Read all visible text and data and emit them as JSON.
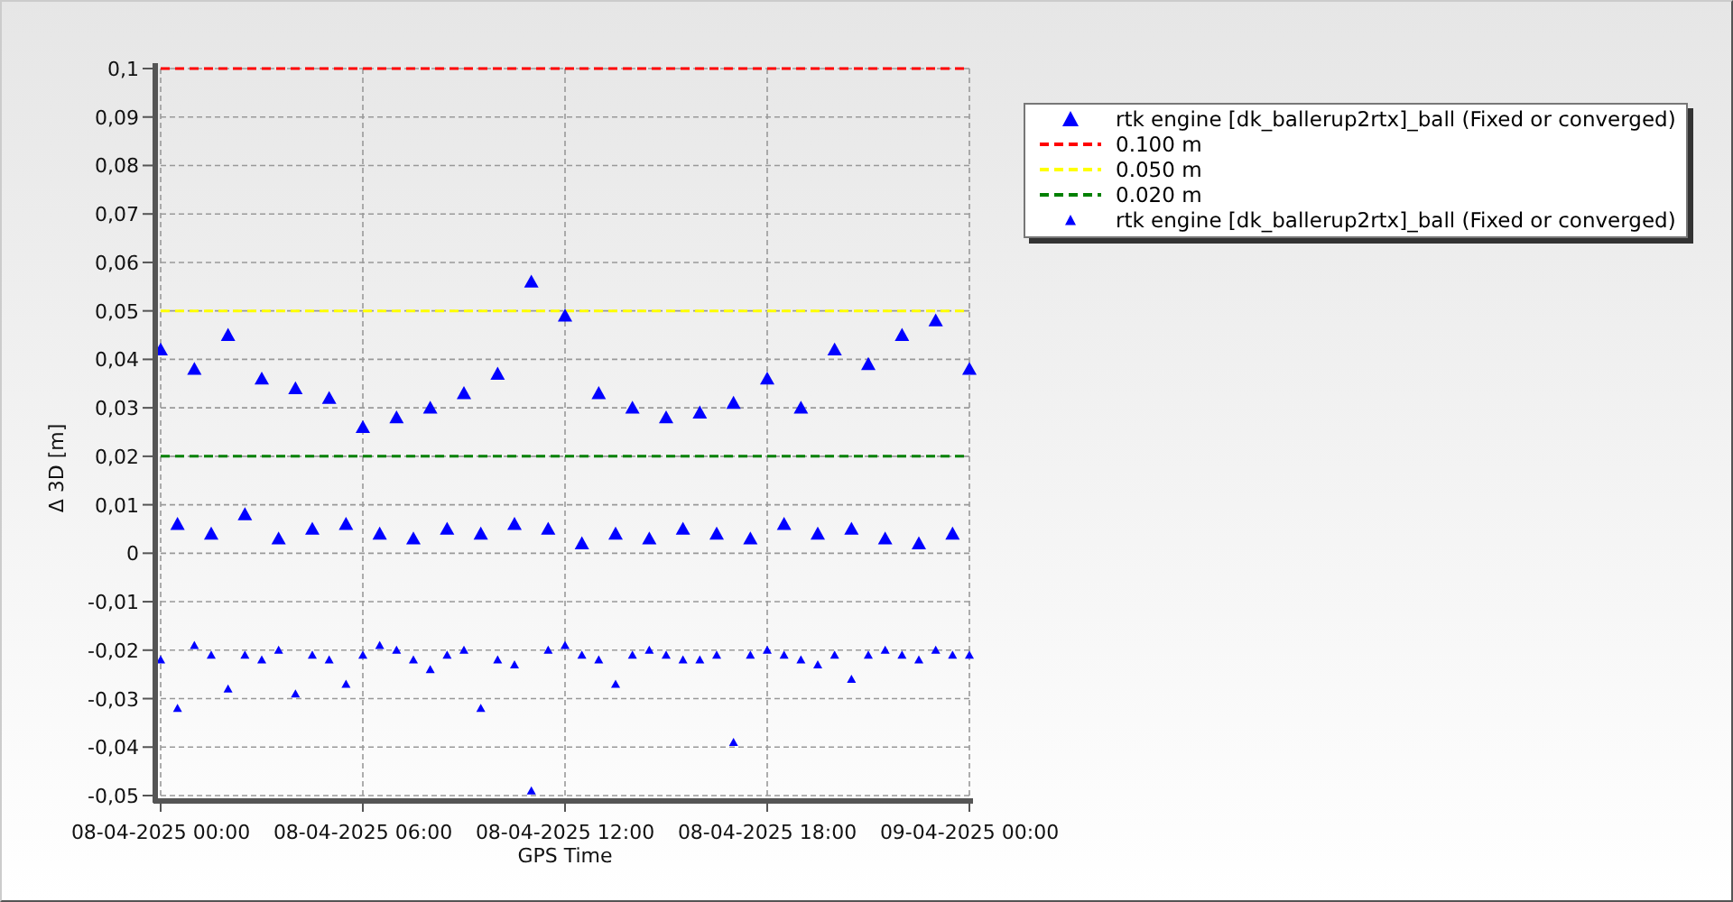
{
  "chart": {
    "chart_data": {
      "type": "scatter",
      "grid": true,
      "xlabel": "GPS Time",
      "ylabel": "Δ 3D [m]",
      "categories": [
        "08-04-2025 00:00",
        null,
        null,
        null,
        null,
        null,
        null,
        null,
        null,
        null,
        null,
        null,
        "08-04-2025 06:00",
        null,
        null,
        null,
        null,
        null,
        null,
        null,
        null,
        null,
        null,
        null,
        "08-04-2025 12:00",
        null,
        null,
        null,
        null,
        null,
        null,
        null,
        null,
        null,
        null,
        null,
        "08-04-2025 18:00",
        null,
        null,
        null,
        null,
        null,
        null,
        null,
        null,
        null,
        null,
        null,
        "09-04-2025 00:00"
      ],
      "ylim": [
        -0.05,
        0.1
      ],
      "yticks": [
        {
          "value": 0.1,
          "label": "0,1"
        },
        {
          "value": 0.09,
          "label": "0,09"
        },
        {
          "value": 0.08,
          "label": "0,08"
        },
        {
          "value": 0.07,
          "label": "0,07"
        },
        {
          "value": 0.06,
          "label": "0,06"
        },
        {
          "value": 0.05,
          "label": "0,05"
        },
        {
          "value": 0.04,
          "label": "0,04"
        },
        {
          "value": 0.03,
          "label": "0,03"
        },
        {
          "value": 0.02,
          "label": "0,02"
        },
        {
          "value": 0.01,
          "label": "0,01"
        },
        {
          "value": 0,
          "label": "0"
        },
        {
          "value": -0.01,
          "label": "-0,01"
        },
        {
          "value": -0.02,
          "label": "-0,02"
        },
        {
          "value": -0.03,
          "label": "-0,03"
        },
        {
          "value": -0.04,
          "label": "-0,04"
        },
        {
          "value": -0.05,
          "label": "-0,05"
        }
      ],
      "series": [
        {
          "name": "rtk engine [dk_ballerup2rtx]_ball (Fixed or converged)",
          "type": "scatter",
          "color": "#0000ff",
          "values": [
            0.042,
            0.006,
            0.038,
            0.004,
            0.045,
            0.008,
            0.036,
            0.003,
            0.034,
            0.005,
            0.032,
            0.006,
            0.026,
            0.004,
            0.028,
            0.003,
            0.03,
            0.005,
            0.033,
            0.004,
            0.037,
            0.006,
            0.056,
            0.005,
            0.049,
            0.002,
            0.033,
            0.004,
            0.03,
            0.003,
            0.028,
            0.005,
            0.029,
            0.004,
            0.031,
            0.003,
            0.036,
            0.006,
            0.03,
            0.004,
            0.042,
            0.005,
            0.039,
            0.003,
            0.045,
            0.002,
            0.048,
            0.004,
            0.038
          ]
        },
        {
          "name": "0.100 m",
          "type": "line",
          "line_style": "dashed",
          "color": "#ff0000",
          "values": [
            0.1,
            0.1,
            0.1,
            0.1,
            0.1,
            0.1,
            0.1,
            0.1,
            0.1,
            0.1,
            0.1,
            0.1,
            0.1,
            0.1,
            0.1,
            0.1,
            0.1,
            0.1,
            0.1,
            0.1,
            0.1,
            0.1,
            0.1,
            0.1,
            0.1,
            0.1,
            0.1,
            0.1,
            0.1,
            0.1,
            0.1,
            0.1,
            0.1,
            0.1,
            0.1,
            0.1,
            0.1,
            0.1,
            0.1,
            0.1,
            0.1,
            0.1,
            0.1,
            0.1,
            0.1,
            0.1,
            0.1,
            0.1,
            0.1
          ]
        },
        {
          "name": "0.050 m",
          "type": "line",
          "line_style": "dashed",
          "color": "#ffff00",
          "values": [
            0.05,
            0.05,
            0.05,
            0.05,
            0.05,
            0.05,
            0.05,
            0.05,
            0.05,
            0.05,
            0.05,
            0.05,
            0.05,
            0.05,
            0.05,
            0.05,
            0.05,
            0.05,
            0.05,
            0.05,
            0.05,
            0.05,
            0.05,
            0.05,
            0.05,
            0.05,
            0.05,
            0.05,
            0.05,
            0.05,
            0.05,
            0.05,
            0.05,
            0.05,
            0.05,
            0.05,
            0.05,
            0.05,
            0.05,
            0.05,
            0.05,
            0.05,
            0.05,
            0.05,
            0.05,
            0.05,
            0.05,
            0.05,
            0.05
          ]
        },
        {
          "name": "0.020 m",
          "type": "line",
          "line_style": "dashed",
          "color": "#008000",
          "values": [
            0.02,
            0.02,
            0.02,
            0.02,
            0.02,
            0.02,
            0.02,
            0.02,
            0.02,
            0.02,
            0.02,
            0.02,
            0.02,
            0.02,
            0.02,
            0.02,
            0.02,
            0.02,
            0.02,
            0.02,
            0.02,
            0.02,
            0.02,
            0.02,
            0.02,
            0.02,
            0.02,
            0.02,
            0.02,
            0.02,
            0.02,
            0.02,
            0.02,
            0.02,
            0.02,
            0.02,
            0.02,
            0.02,
            0.02,
            0.02,
            0.02,
            0.02,
            0.02,
            0.02,
            0.02,
            0.02,
            0.02,
            0.02,
            0.02
          ]
        },
        {
          "name": "rtk engine [dk_ballerup2rtx]_ball (Fixed or converged)",
          "type": "scatter",
          "color": "#0000ff",
          "values": [
            -0.022,
            -0.032,
            -0.019,
            -0.021,
            -0.028,
            -0.021,
            -0.022,
            -0.02,
            -0.029,
            -0.021,
            -0.022,
            -0.027,
            -0.021,
            -0.019,
            -0.02,
            -0.022,
            -0.024,
            -0.021,
            -0.02,
            -0.032,
            -0.022,
            -0.023,
            -0.049,
            -0.02,
            -0.019,
            -0.021,
            -0.022,
            -0.027,
            -0.021,
            -0.02,
            -0.021,
            -0.022,
            -0.022,
            -0.021,
            -0.039,
            -0.021,
            -0.02,
            -0.021,
            -0.022,
            -0.023,
            -0.021,
            -0.026,
            -0.021,
            -0.02,
            -0.021,
            -0.022,
            -0.02,
            -0.021,
            -0.021
          ]
        }
      ]
    }
  }
}
